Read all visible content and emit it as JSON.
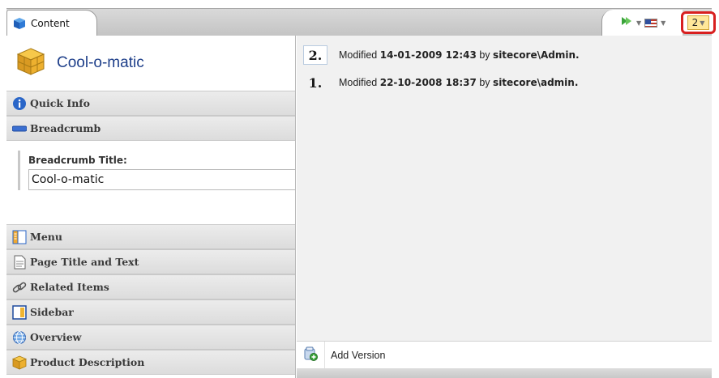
{
  "tab": {
    "label": "Content",
    "icon": "content-cube-icon"
  },
  "toolbar": {
    "navigate_icon": "green-arrow-icon",
    "language_icon": "us-flag-icon",
    "version_selector": "2"
  },
  "item": {
    "title": "Cool-o-matic",
    "icon": "yellow-cube-icon"
  },
  "sections": [
    {
      "label": "Quick Info",
      "icon": "info-icon"
    },
    {
      "label": "Breadcrumb",
      "icon": "breadcrumb-icon"
    },
    {
      "label": "Menu",
      "icon": "menu-icon"
    },
    {
      "label": "Page Title and Text",
      "icon": "document-icon"
    },
    {
      "label": "Related Items",
      "icon": "link-icon"
    },
    {
      "label": "Sidebar",
      "icon": "sidebar-icon"
    },
    {
      "label": "Overview",
      "icon": "globe-icon"
    },
    {
      "label": "Product Description",
      "icon": "cube-icon"
    }
  ],
  "breadcrumb_field": {
    "label": "Breadcrumb Title:",
    "value": "Cool-o-matic"
  },
  "versions": [
    {
      "number": "2.",
      "prefix": "Modified",
      "date": "14-01-2009 12:43",
      "by": "by",
      "user": "sitecore\\Admin."
    },
    {
      "number": "1.",
      "prefix": "Modified",
      "date": "22-10-2008 18:37",
      "by": "by",
      "user": "sitecore\\admin."
    }
  ],
  "add_version": {
    "label": "Add Version",
    "icon": "add-version-icon"
  },
  "colors": {
    "highlight_border": "#d81f1f",
    "version_button": "#ffe89a",
    "title": "#1e3f8a"
  }
}
